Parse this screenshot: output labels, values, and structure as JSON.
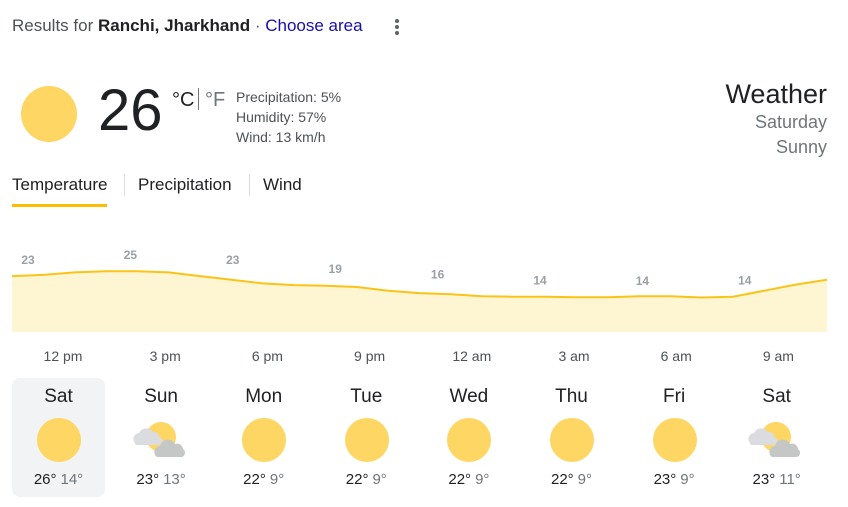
{
  "header": {
    "prefix": "Results for",
    "location": "Ranchi, Jharkhand",
    "separator": "·",
    "choose_area": "Choose area"
  },
  "current": {
    "temperature": "26",
    "unit_c": "°C",
    "unit_f": "°F",
    "precipitation": "Precipitation: 5%",
    "humidity": "Humidity: 57%",
    "wind": "Wind: 13 km/h",
    "icon": "sun-icon"
  },
  "summary": {
    "title": "Weather",
    "day": "Saturday",
    "condition": "Sunny"
  },
  "tabs": [
    {
      "label": "Temperature",
      "active": true
    },
    {
      "label": "Precipitation",
      "active": false
    },
    {
      "label": "Wind",
      "active": false
    }
  ],
  "chart_data": {
    "type": "area",
    "x": [
      "12 pm",
      "3 pm",
      "6 pm",
      "9 pm",
      "12 am",
      "3 am",
      "6 am",
      "9 am"
    ],
    "values": [
      23,
      25,
      23,
      19,
      16,
      14,
      14,
      14
    ],
    "series_hourly": [
      23,
      23.5,
      24.5,
      25,
      25,
      24.5,
      23,
      21.5,
      20,
      19.3,
      19,
      18.5,
      17,
      16,
      15.5,
      14.7,
      14.5,
      14.5,
      14.3,
      14.3,
      14.7,
      14.7,
      14.2,
      14.5,
      17,
      19.5,
      21.5
    ],
    "ylim": [
      0,
      44
    ],
    "colors": {
      "line": "#fbc316",
      "fill": "#fef6d3",
      "label": "#9aa0a6"
    }
  },
  "daily": [
    {
      "day": "Sat",
      "hi": "26°",
      "lo": "14°",
      "icon": "sun-icon",
      "selected": true
    },
    {
      "day": "Sun",
      "hi": "23°",
      "lo": "13°",
      "icon": "partly-cloudy-icon",
      "selected": false
    },
    {
      "day": "Mon",
      "hi": "22°",
      "lo": "9°",
      "icon": "sun-icon",
      "selected": false
    },
    {
      "day": "Tue",
      "hi": "22°",
      "lo": "9°",
      "icon": "sun-icon",
      "selected": false
    },
    {
      "day": "Wed",
      "hi": "22°",
      "lo": "9°",
      "icon": "sun-icon",
      "selected": false
    },
    {
      "day": "Thu",
      "hi": "22°",
      "lo": "9°",
      "icon": "sun-icon",
      "selected": false
    },
    {
      "day": "Fri",
      "hi": "23°",
      "lo": "9°",
      "icon": "sun-icon",
      "selected": false
    },
    {
      "day": "Sat",
      "hi": "23°",
      "lo": "11°",
      "icon": "partly-cloudy-icon",
      "selected": false
    }
  ]
}
